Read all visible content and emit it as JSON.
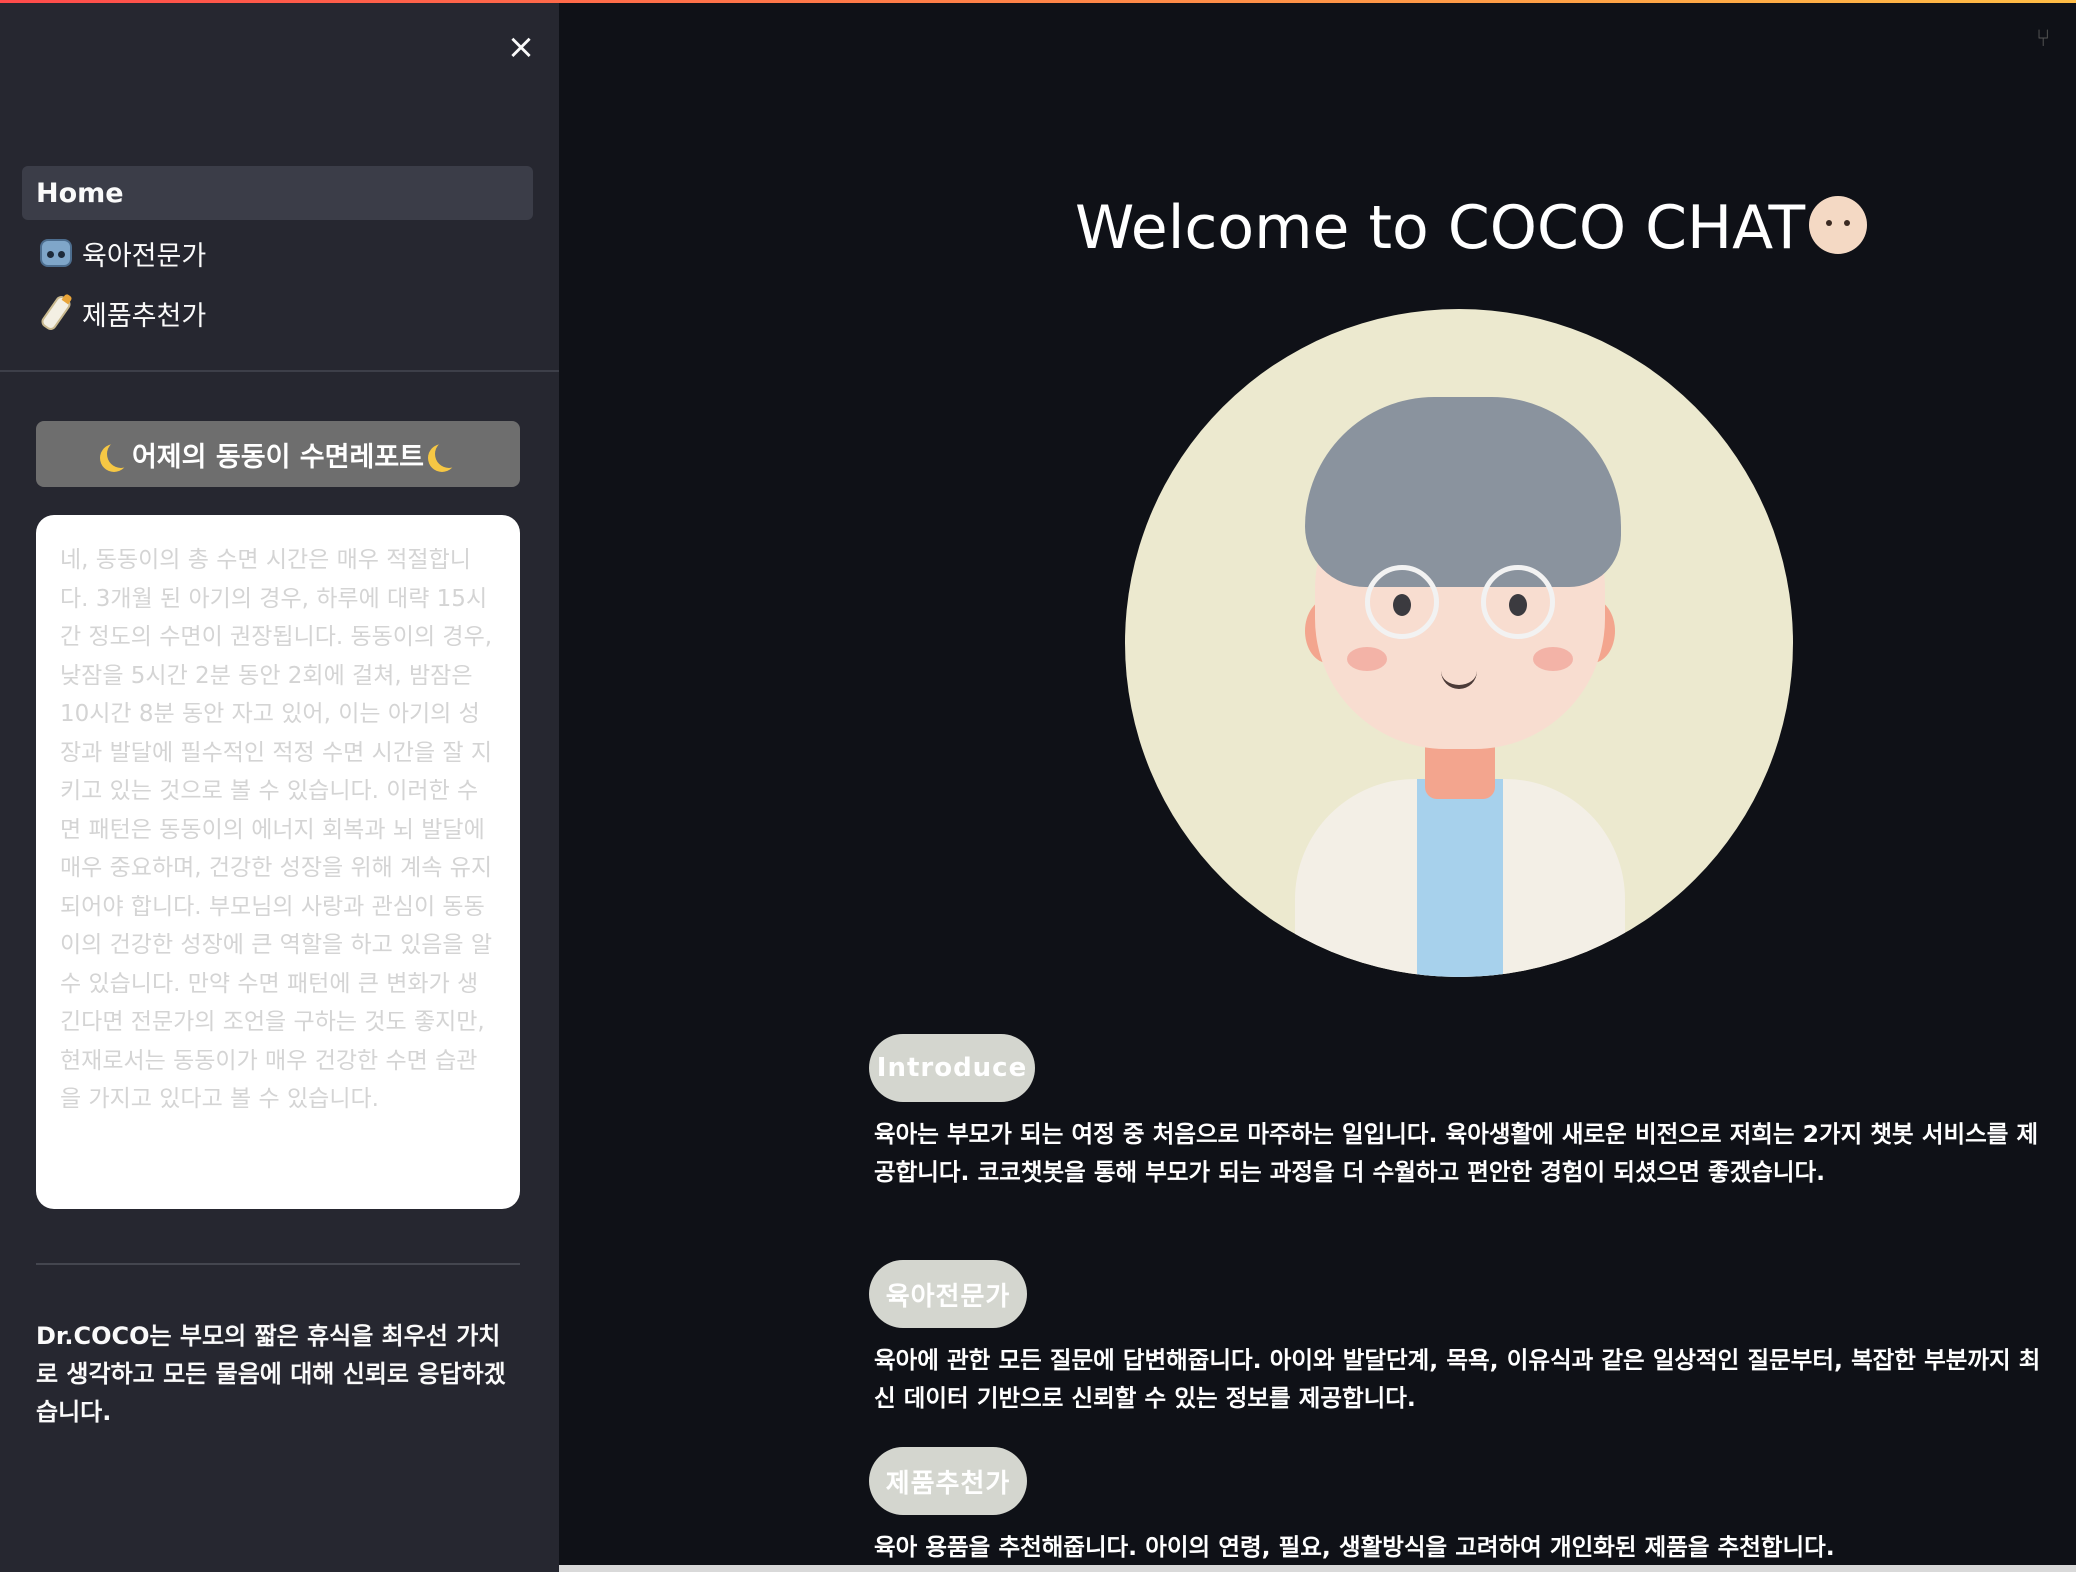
{
  "sidebar": {
    "close_label": "×",
    "nav": [
      {
        "label": "Home",
        "icon": "",
        "active": true
      },
      {
        "label": "육아전문가",
        "icon": "robot-icon"
      },
      {
        "label": "제품추천가",
        "icon": "baby-bottle-icon"
      }
    ],
    "report_button": "어제의 동동이 수면레포트",
    "report_text": "네, 동동이의 총 수면 시간은 매우 적절합니다. 3개월 된 아기의 경우, 하루에 대략 15시간 정도의 수면이 권장됩니다. 동동이의 경우, 낮잠을 5시간 2분 동안 2회에 걸쳐, 밤잠은 10시간 8분 동안 자고 있어, 이는 아기의 성장과 발달에 필수적인 적정 수면 시간을 잘 지키고 있는 것으로 볼 수 있습니다. 이러한 수면 패턴은 동동이의 에너지 회복과 뇌 발달에 매우 중요하며, 건강한 성장을 위해 계속 유지되어야 합니다. 부모님의 사랑과 관심이 동동이의 건강한 성장에 큰 역할을 하고 있음을 알 수 있습니다. 만약 수면 패턴에 큰 변화가 생긴다면 전문가의 조언을 구하는 것도 좋지만, 현재로서는 동동이가 매우 건강한 수면 습관을 가지고 있다고 볼 수 있습니다.",
    "note": "Dr.COCO는 부모의 짧은 휴식을 최우선 가치로 생각하고 모든 물음에 대해 신뢰로 응답하겠습니다."
  },
  "main": {
    "title": "Welcome to COCO CHAT",
    "sections": [
      {
        "label": "Introduce",
        "text": "육아는 부모가 되는 여정 중 처음으로 마주하는 일입니다. 육아생활에 새로운 비전으로 저희는 2가지 챗봇 서비스를 제공합니다. 코코챗봇을 통해 부모가 되는 과정을 더 수월하고 편안한 경험이 되셨으면 좋겠습니다."
      },
      {
        "label": "육아전문가",
        "text": "육아에 관한 모든 질문에 답변해줍니다. 아이와 발달단계, 목욕, 이유식과 같은 일상적인 질문부터, 복잡한 부분까지 최신 데이터 기반으로 신뢰할 수 있는 정보를 제공합니다."
      },
      {
        "label": "제품추천가",
        "text": "육아 용품을 추천해줍니다. 아이의 연령, 필요, 생활방식을 고려하여 개인화된 제품을 추천합니다."
      }
    ]
  },
  "colors": {
    "sidebar_bg": "#262730",
    "main_bg": "#0f1117",
    "pill_bg": "#d4d6cf",
    "report_button_bg": "#6e6e6e"
  }
}
